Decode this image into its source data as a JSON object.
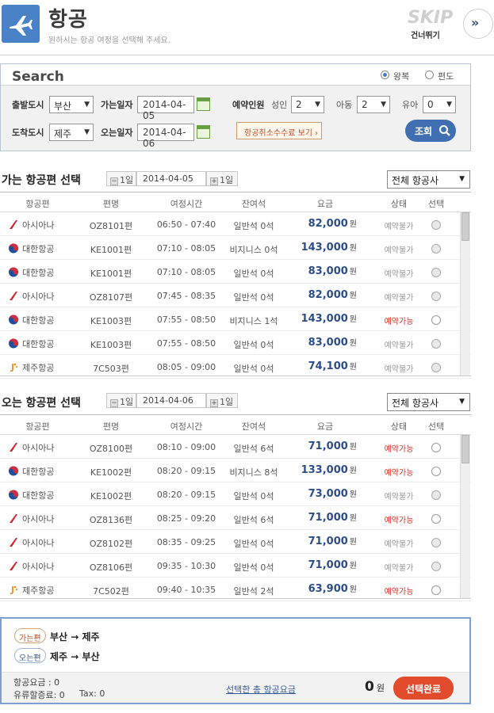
{
  "header": {
    "title": "항공",
    "subtitle": "원하시는 항공 여정을 선택해 주세요.",
    "skip_label": "SKIP",
    "skip_sub": "건너뛰기",
    "skip_icon": "double-chevron-right-icon",
    "logo_icon": "airplane-icon",
    "brand_color": "#4a82c8"
  },
  "search": {
    "title": "Search",
    "trip_roundtrip": "왕복",
    "trip_oneway": "편도",
    "trip_selected": "왕복",
    "depart_city_label": "출발도시",
    "depart_city": "부산",
    "arrive_city_label": "도착도시",
    "arrive_city": "제주",
    "depart_date_label": "가는일자",
    "depart_date": "2014-04-05",
    "return_date_label": "오는일자",
    "return_date": "2014-04-06",
    "pax_label": "예약인원",
    "adult_label": "성인",
    "adult": "2",
    "child_label": "아동",
    "child": "2",
    "infant_label": "유아",
    "infant": "0",
    "fee_button": "항공취소수수료 보기",
    "search_button": "조회"
  },
  "columns": [
    "항공편",
    "편명",
    "여정시간",
    "잔여석",
    "요금",
    "상태",
    "선택"
  ],
  "outbound": {
    "title": "가는 항공편 선택",
    "prev_label": "1일",
    "date": "2014-04-05",
    "next_label": "1일",
    "airline_filter": "전체 항공사",
    "rows": [
      {
        "airline": "아시아나",
        "logo": "asiana",
        "flight": "OZ8101편",
        "time": "06:50 - 07:40",
        "seats": "일반석 0석",
        "fare": "82,000",
        "unit": "원",
        "status": "예약불가",
        "available": false
      },
      {
        "airline": "대한항공",
        "logo": "korean",
        "flight": "KE1001편",
        "time": "07:10 - 08:05",
        "seats": "비지니스 0석",
        "fare": "143,000",
        "unit": "원",
        "status": "예약불가",
        "available": false
      },
      {
        "airline": "대한항공",
        "logo": "korean",
        "flight": "KE1001편",
        "time": "07:10 - 08:05",
        "seats": "일반석 0석",
        "fare": "83,000",
        "unit": "원",
        "status": "예약불가",
        "available": false
      },
      {
        "airline": "아시아나",
        "logo": "asiana",
        "flight": "OZ8107편",
        "time": "07:45 - 08:35",
        "seats": "일반석 0석",
        "fare": "82,000",
        "unit": "원",
        "status": "예약불가",
        "available": false
      },
      {
        "airline": "대한항공",
        "logo": "korean",
        "flight": "KE1003편",
        "time": "07:55 - 08:50",
        "seats": "비지니스 1석",
        "fare": "143,000",
        "unit": "원",
        "status": "예약가능",
        "available": true
      },
      {
        "airline": "대한항공",
        "logo": "korean",
        "flight": "KE1003편",
        "time": "07:55 - 08:50",
        "seats": "일반석 0석",
        "fare": "83,000",
        "unit": "원",
        "status": "예약불가",
        "available": false
      },
      {
        "airline": "제주항공",
        "logo": "jeju",
        "flight": "7C503편",
        "time": "08:05 - 09:00",
        "seats": "일반석 0석",
        "fare": "74,100",
        "unit": "원",
        "status": "예약불가",
        "available": false
      }
    ]
  },
  "inbound": {
    "title": "오는 항공편 선택",
    "prev_label": "1일",
    "date": "2014-04-06",
    "next_label": "1일",
    "airline_filter": "전체 항공사",
    "rows": [
      {
        "airline": "아시아나",
        "logo": "asiana",
        "flight": "OZ8100편",
        "time": "08:10 - 09:00",
        "seats": "일반석 6석",
        "fare": "71,000",
        "unit": "원",
        "status": "예약가능",
        "available": true
      },
      {
        "airline": "대한항공",
        "logo": "korean",
        "flight": "KE1002편",
        "time": "08:20 - 09:15",
        "seats": "비지니스 8석",
        "fare": "133,000",
        "unit": "원",
        "status": "예약가능",
        "available": true
      },
      {
        "airline": "대한항공",
        "logo": "korean",
        "flight": "KE1002편",
        "time": "08:20 - 09:15",
        "seats": "일반석 0석",
        "fare": "73,000",
        "unit": "원",
        "status": "예약불가",
        "available": false
      },
      {
        "airline": "아시아나",
        "logo": "asiana",
        "flight": "OZ8136편",
        "time": "08:25 - 09:20",
        "seats": "일반석 6석",
        "fare": "71,000",
        "unit": "원",
        "status": "예약가능",
        "available": true
      },
      {
        "airline": "아시아나",
        "logo": "asiana",
        "flight": "OZ8102편",
        "time": "08:35 - 09:25",
        "seats": "일반석 0석",
        "fare": "71,000",
        "unit": "원",
        "status": "예약불가",
        "available": false
      },
      {
        "airline": "아시아나",
        "logo": "asiana",
        "flight": "OZ8106편",
        "time": "09:35 - 10:30",
        "seats": "일반석 0석",
        "fare": "71,000",
        "unit": "원",
        "status": "예약불가",
        "available": false
      },
      {
        "airline": "제주항공",
        "logo": "jeju",
        "flight": "7C502편",
        "time": "09:40 - 10:35",
        "seats": "일반석 2석",
        "fare": "63,900",
        "unit": "원",
        "status": "예약가능",
        "available": true
      }
    ]
  },
  "summary": {
    "out_tag": "가는편",
    "out_route": "부산 → 제주",
    "in_tag": "오는편",
    "in_route": "제주 → 부산",
    "fare_label": "항공요금 : 0",
    "fuel_label": "유류할증료: 0",
    "tax_label": "Tax: 0",
    "total_link": "선택한 총 항공요금",
    "total_value": "0",
    "total_unit": "원",
    "done_button": "선택완료"
  },
  "colors": {
    "available": "#d6332b",
    "unavailable": "#999999",
    "fare": "#2c4c8a",
    "asiana": "#d61f2b",
    "korean_red": "#cf2e3c",
    "korean_blue": "#1f4f9e",
    "jeju": "#f28a1e"
  }
}
